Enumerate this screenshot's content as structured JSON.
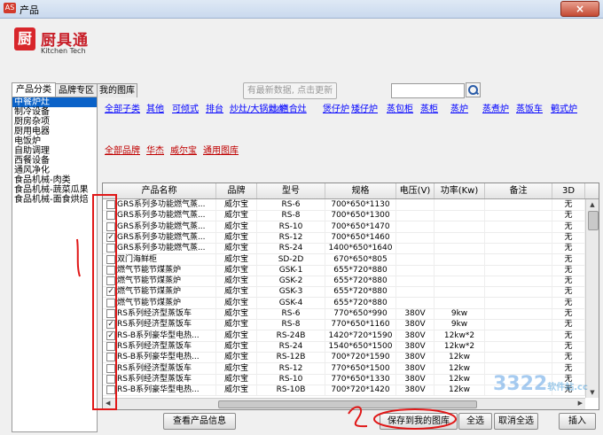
{
  "window": {
    "title": "产品",
    "app_icon_text": "AS",
    "close_label": "×"
  },
  "logo": {
    "mark": "厨",
    "cn": "厨具通",
    "en": "Kitchen Tech"
  },
  "tabs": [
    {
      "label": "产品分类"
    },
    {
      "label": "品牌专区"
    },
    {
      "label": "我的图库"
    }
  ],
  "tree_items": [
    "中餐炉灶",
    "制冷设备",
    "厨房杂项",
    "厨用电器",
    "电饭炉",
    "自助调理",
    "西餐设备",
    "通风净化",
    "食品机械-肉类",
    "食品机械-蔬菜瓜果",
    "食品机械-面食烘焙"
  ],
  "refresh_button": "有最新数据, 点击更新",
  "category_links": [
    "全部子类",
    "其他",
    "可倾式",
    "排台",
    "炒灶/大锅灶/组合灶",
    "炒炉",
    "煲仔炉",
    "矮仔炉",
    "蒸包柜",
    "蒸柜",
    "蒸炉",
    "蒸煮炉",
    "蒸饭车",
    "鹌式炉"
  ],
  "brand_links": [
    "全部品牌",
    "华杰",
    "威尔宝",
    "通用图库"
  ],
  "table": {
    "headers": [
      "产品名称",
      "品牌",
      "型号",
      "规格",
      "电压(V)",
      "功率(Kw)",
      "备注",
      "3D"
    ],
    "rows": [
      {
        "checked": false,
        "name": "GRS系列多功能燃气蒸...",
        "brand": "威尔宝",
        "model": "RS-6",
        "spec": "700*650*1130",
        "voltage": "",
        "power": "",
        "note": "",
        "d3": "无"
      },
      {
        "checked": false,
        "name": "GRS系列多功能燃气蒸...",
        "brand": "威尔宝",
        "model": "RS-8",
        "spec": "700*650*1300",
        "voltage": "",
        "power": "",
        "note": "",
        "d3": "无"
      },
      {
        "checked": false,
        "name": "GRS系列多功能燃气蒸...",
        "brand": "威尔宝",
        "model": "RS-10",
        "spec": "700*650*1470",
        "voltage": "",
        "power": "",
        "note": "",
        "d3": "无"
      },
      {
        "checked": true,
        "name": "GRS系列多功能燃气蒸...",
        "brand": "威尔宝",
        "model": "RS-12",
        "spec": "700*650*1460",
        "voltage": "",
        "power": "",
        "note": "",
        "d3": "无"
      },
      {
        "checked": false,
        "name": "GRS系列多功能燃气蒸...",
        "brand": "威尔宝",
        "model": "RS-24",
        "spec": "1400*650*1640",
        "voltage": "",
        "power": "",
        "note": "",
        "d3": "无"
      },
      {
        "checked": false,
        "name": "双门海鲜柜",
        "brand": "威尔宝",
        "model": "SD-2D",
        "spec": "670*650*805",
        "voltage": "",
        "power": "",
        "note": "",
        "d3": "无"
      },
      {
        "checked": false,
        "name": "燃气节能节煤蒸炉",
        "brand": "威尔宝",
        "model": "GSK-1",
        "spec": "655*720*880",
        "voltage": "",
        "power": "",
        "note": "",
        "d3": "无"
      },
      {
        "checked": false,
        "name": "燃气节能节煤蒸炉",
        "brand": "威尔宝",
        "model": "GSK-2",
        "spec": "655*720*880",
        "voltage": "",
        "power": "",
        "note": "",
        "d3": "无"
      },
      {
        "checked": true,
        "name": "燃气节能节煤蒸炉",
        "brand": "威尔宝",
        "model": "GSK-3",
        "spec": "655*720*880",
        "voltage": "",
        "power": "",
        "note": "",
        "d3": "无"
      },
      {
        "checked": false,
        "name": "燃气节能节煤蒸炉",
        "brand": "威尔宝",
        "model": "GSK-4",
        "spec": "655*720*880",
        "voltage": "",
        "power": "",
        "note": "",
        "d3": "无"
      },
      {
        "checked": false,
        "name": "RS系列经济型蒸饭车",
        "brand": "威尔宝",
        "model": "RS-6",
        "spec": "770*650*990",
        "voltage": "380V",
        "power": "9kw",
        "note": "",
        "d3": "无"
      },
      {
        "checked": true,
        "name": "RS系列经济型蒸饭车",
        "brand": "威尔宝",
        "model": "RS-8",
        "spec": "770*650*1160",
        "voltage": "380V",
        "power": "9kw",
        "note": "",
        "d3": "无"
      },
      {
        "checked": true,
        "name": "RS-B系列豪华型电热...",
        "brand": "威尔宝",
        "model": "RS-24B",
        "spec": "1420*720*1590",
        "voltage": "380V",
        "power": "12kw*2",
        "note": "",
        "d3": "无"
      },
      {
        "checked": false,
        "name": "RS系列经济型蒸饭车",
        "brand": "威尔宝",
        "model": "RS-24",
        "spec": "1540*650*1500",
        "voltage": "380V",
        "power": "12kw*2",
        "note": "",
        "d3": "无"
      },
      {
        "checked": false,
        "name": "RS-B系列豪华型电热...",
        "brand": "威尔宝",
        "model": "RS-12B",
        "spec": "700*720*1590",
        "voltage": "380V",
        "power": "12kw",
        "note": "",
        "d3": "无"
      },
      {
        "checked": false,
        "name": "RS系列经济型蒸饭车",
        "brand": "威尔宝",
        "model": "RS-12",
        "spec": "770*650*1500",
        "voltage": "380V",
        "power": "12kw",
        "note": "",
        "d3": "无"
      },
      {
        "checked": false,
        "name": "RS系列经济型蒸饭车",
        "brand": "威尔宝",
        "model": "RS-10",
        "spec": "770*650*1330",
        "voltage": "380V",
        "power": "12kw",
        "note": "",
        "d3": "无"
      },
      {
        "checked": false,
        "name": "RS-B系列豪华型电热...",
        "brand": "威尔宝",
        "model": "RS-10B",
        "spec": "700*720*1420",
        "voltage": "380V",
        "power": "12kw",
        "note": "",
        "d3": "无"
      }
    ]
  },
  "buttons": {
    "view_info": "查看产品信息",
    "save_to_library": "保存到我的图库",
    "select_all": "全选",
    "cancel_select_all": "取消全选",
    "insert": "插入"
  },
  "watermark": {
    "main": "3322",
    "sub": "软件站",
    "domain": ".cc"
  },
  "annotation_color": "#e01818"
}
